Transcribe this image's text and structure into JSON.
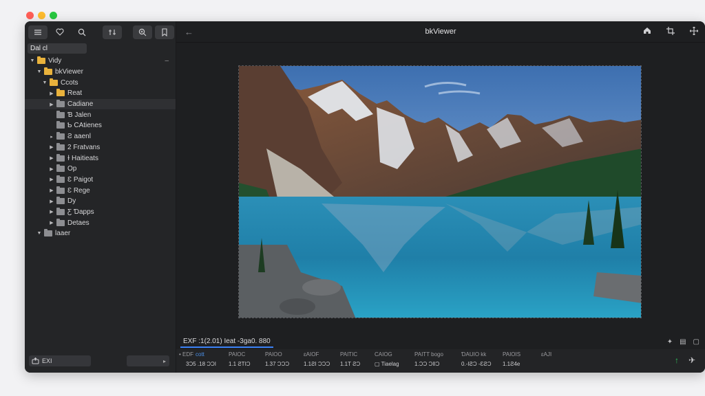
{
  "app": {
    "title": "bkViewer"
  },
  "sidebar": {
    "search_value": "Dal cl",
    "tree": [
      {
        "label": "Vidy",
        "arrow": "▼",
        "icon": "yellow",
        "indent": 0,
        "trailing": "–"
      },
      {
        "label": "bkViewer",
        "arrow": "▼",
        "icon": "yellow",
        "indent": 1
      },
      {
        "label": "Ccots",
        "arrow": "▼",
        "icon": "yellow",
        "indent": 2
      },
      {
        "label": "Reat",
        "arrow": "▶",
        "icon": "yellow",
        "indent": 3
      },
      {
        "label": "Cadiane",
        "arrow": "▶",
        "icon": "gray",
        "indent": 3,
        "selected": true
      },
      {
        "label": "Ɓ Jalen",
        "arrow": "",
        "icon": "gray",
        "indent": 3
      },
      {
        "label": "Ƅ CAtienes",
        "arrow": "",
        "icon": "gray",
        "indent": 3
      },
      {
        "label": "Ƨ aaenl",
        "arrow": "▸",
        "icon": "gray",
        "indent": 3
      },
      {
        "label": "2 Fratvans",
        "arrow": "▶",
        "icon": "gray",
        "indent": 3
      },
      {
        "label": "ɫ Haitieats",
        "arrow": "▶",
        "icon": "gray",
        "indent": 3
      },
      {
        "label": "Op",
        "arrow": "▶",
        "icon": "gray",
        "indent": 3
      },
      {
        "label": "Ɛ Paigot",
        "arrow": "▶",
        "icon": "gray",
        "indent": 3
      },
      {
        "label": "Ɛ Rege",
        "arrow": "▶",
        "icon": "gray",
        "indent": 3
      },
      {
        "label": "Dy",
        "arrow": "▶",
        "icon": "gray",
        "indent": 3
      },
      {
        "label": "Ƹ Ɗapps",
        "arrow": "▶",
        "icon": "gray",
        "indent": 3
      },
      {
        "label": "Detaes",
        "arrow": "▶",
        "icon": "gray",
        "indent": 3
      },
      {
        "label": "laaer",
        "arrow": "▼",
        "icon": "gray",
        "indent": 1
      }
    ],
    "bottom_field_label": "EXI"
  },
  "info": {
    "tab_label": "EXF :1(2.01)   Ieat -3ga0. 880"
  },
  "exif": {
    "headers": [
      "• EDF",
      "cott",
      "PAIOC",
      "PAIOO",
      "ɛAIOF",
      "PAITIC",
      "CAIOG",
      "PAITT  bogo",
      "ƊAUIO  kk",
      "PAIOIS",
      "ɛAJI"
    ],
    "values": [
      "3Ɔ5 .18 ƆƆI",
      "1.1 ƧTIƆ",
      "1.37 ƆƆƆ",
      "1.1ƧI ƆƆƆ",
      "1.1T ƧƆ",
      "▢ Tiaelag",
      "1.ƆƆ ƆIIƆ",
      "0.-IƧƆ  -ƐƧƆ",
      "1.1Ƨ4e"
    ]
  },
  "icons": {
    "toolbar": [
      "sidebar-toggle-icon",
      "heart-icon",
      "search-icon",
      "adjust-icon",
      "zoom-icon",
      "bookmark-icon"
    ],
    "titlebar": [
      "back-arrow-icon",
      "home-icon",
      "crop-icon",
      "move-icon"
    ],
    "info": [
      "star-icon",
      "info-icon",
      "copy-icon"
    ],
    "exif_actions": [
      "upload-arrow-icon",
      "share-plane-icon"
    ]
  },
  "colors": {
    "accent": "#3b82f6",
    "folder": "#e9b23c",
    "success": "#2fc25b"
  }
}
